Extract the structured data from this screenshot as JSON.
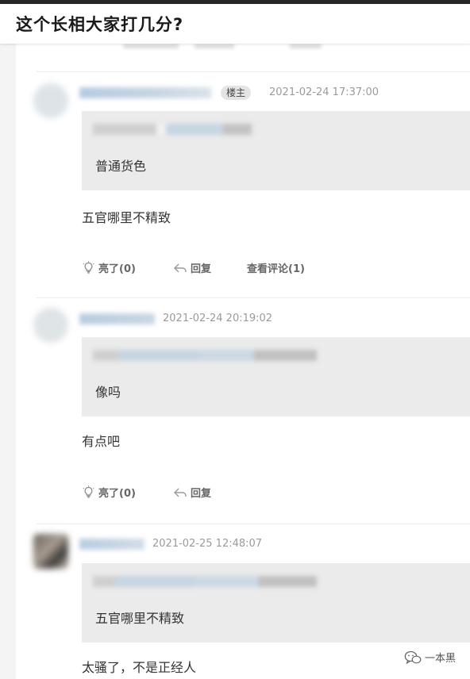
{
  "header": {
    "title": "这个长相大家打几分?"
  },
  "comments": [
    {
      "badge": "楼主",
      "time": "2021-02-24 17:37:00",
      "quote_text": "普通货色",
      "text": "五官哪里不精致",
      "like_label": "亮了(0)",
      "reply_label": "回复",
      "view_label": "查看评论(1)"
    },
    {
      "time": "2021-02-24 20:19:02",
      "quote_text": "像吗",
      "text": "有点吧",
      "like_label": "亮了(0)",
      "reply_label": "回复"
    },
    {
      "time": "2021-02-25 12:48:07",
      "quote_text": "五官哪里不精致",
      "text": "太骚了，不是正经人"
    }
  ],
  "watermark": {
    "text": "一本黑",
    "icon": "wechat-icon"
  },
  "colors": {
    "panel": "#ffffff",
    "quote_bg": "#ebebeb",
    "badge_bg": "#e4e4e4",
    "time": "#9a9a9a"
  }
}
